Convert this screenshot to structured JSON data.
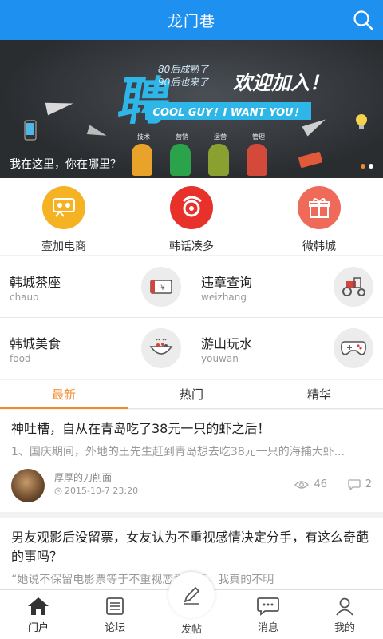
{
  "header": {
    "title": "龙门巷",
    "search_icon": "search-icon"
  },
  "banner": {
    "headline_char": "聘",
    "line1": "80后成熟了",
    "line2": "90后也来了",
    "welcome": "欢迎加入！",
    "slogan": "COOL GUY！I WANT YOU！",
    "roles": [
      "技术",
      "营销",
      "运营",
      "管理"
    ],
    "caption": "我在这里，你在哪里？",
    "page_count": 2,
    "active_page": 1
  },
  "categories": [
    {
      "label": "壹加电商",
      "color": "#f5b324",
      "icon": "chat-people-icon"
    },
    {
      "label": "韩话凑多",
      "color": "#e8312a",
      "icon": "film-icon"
    },
    {
      "label": "微韩城",
      "color": "#f06a5a",
      "icon": "gift-icon"
    }
  ],
  "services": [
    {
      "name": "韩城茶座",
      "sub": "chauo",
      "icon": "money-card-icon"
    },
    {
      "name": "违章查询",
      "sub": "weizhang",
      "icon": "tractor-icon"
    },
    {
      "name": "韩城美食",
      "sub": "food",
      "icon": "food-bowl-icon"
    },
    {
      "name": "游山玩水",
      "sub": "youwan",
      "icon": "gamepad-icon"
    }
  ],
  "tabs": [
    "最新",
    "热门",
    "精华"
  ],
  "active_tab": 0,
  "posts": [
    {
      "title": "神吐槽，自从在青岛吃了38元一只的虾之后！",
      "excerpt": "1、国庆期间，外地的王先生赶到青岛想去吃38元一只的海捕大虾...",
      "author": "厚厚的刀削面",
      "time": "2015-10-7 23:20",
      "views": "46",
      "comments": "2"
    },
    {
      "title": "男友观影后没留票，女友认为不重视感情决定分手，有这么奇葩的事吗？",
      "excerpt": "“她说不保留电影票等于不重视恋爱经历，我真的不明"
    }
  ],
  "bottom_nav": [
    {
      "label": "门户",
      "icon": "home-icon"
    },
    {
      "label": "论坛",
      "icon": "forum-icon"
    },
    {
      "label": "发帖",
      "icon": "pen-icon"
    },
    {
      "label": "消息",
      "icon": "message-icon"
    },
    {
      "label": "我的",
      "icon": "user-icon"
    }
  ],
  "active_nav": 0,
  "colors": {
    "header": "#1e90f0",
    "accent": "#f08a2c"
  }
}
